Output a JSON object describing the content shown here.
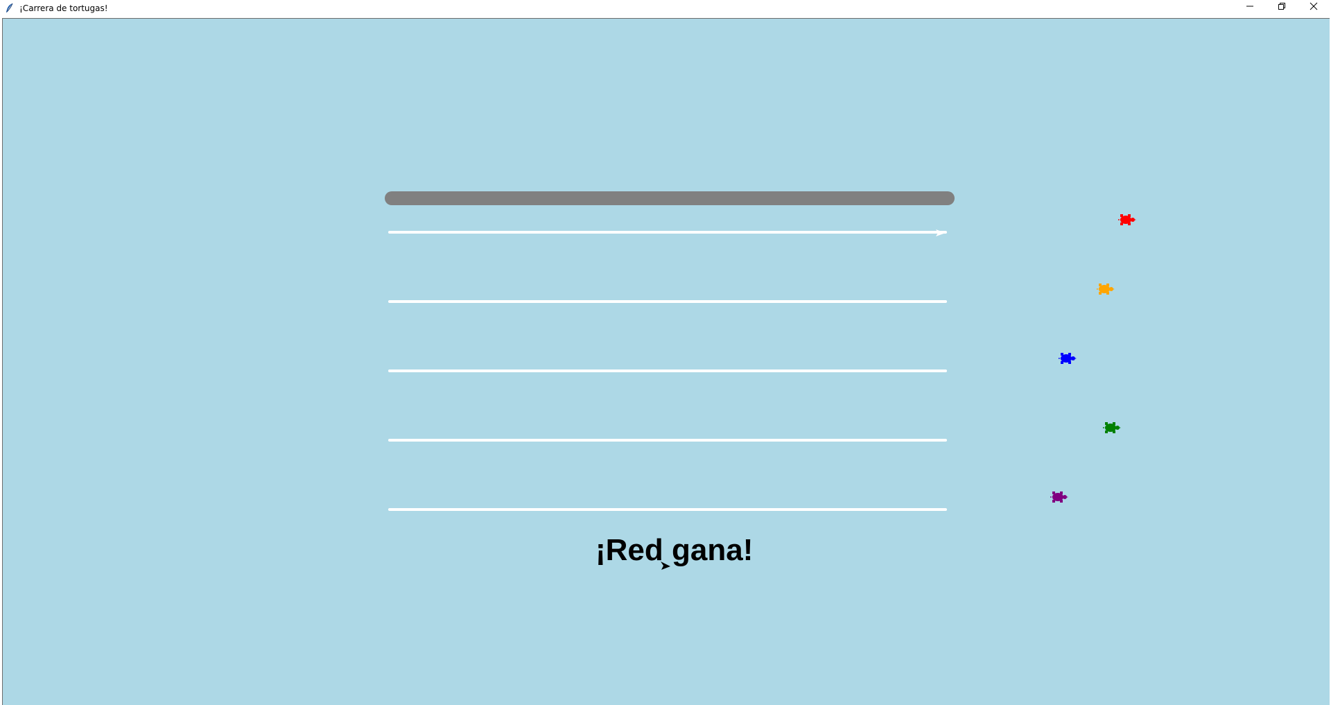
{
  "window": {
    "title": "¡Carrera de tortugas!",
    "icons": {
      "app": "feather-icon",
      "minimize": "minimize-icon",
      "maximize": "restore-icon",
      "close": "close-icon"
    }
  },
  "race": {
    "background_color": "#add8e6",
    "finish_line_color": "#808080",
    "lane_color": "#ffffff",
    "lanes": 5,
    "turtles": [
      {
        "name": "red",
        "color": "#ff0000"
      },
      {
        "name": "orange",
        "color": "#ffa500"
      },
      {
        "name": "blue",
        "color": "#0000ff"
      },
      {
        "name": "green",
        "color": "#008000"
      },
      {
        "name": "purple",
        "color": "#800080"
      }
    ],
    "winner_message": "¡Red gana!"
  }
}
